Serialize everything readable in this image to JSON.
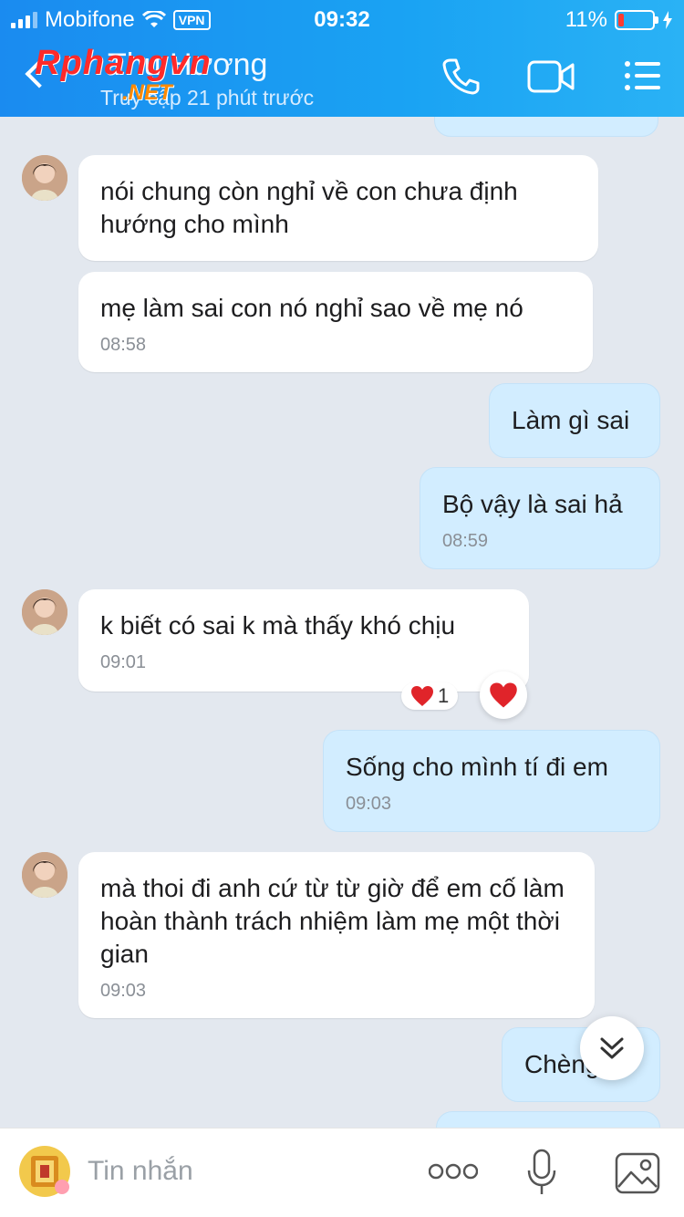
{
  "status_bar": {
    "carrier": "Mobifone",
    "vpn": "VPN",
    "time": "09:32",
    "battery": "11%",
    "battery_level": 0.11
  },
  "header": {
    "contact_name": "Thu Hương",
    "last_seen": "Truy cập 21 phút trước",
    "watermark_main": "Rphangvn",
    "watermark_sub": ".NET",
    "icons": [
      "back-icon",
      "phone-icon",
      "video-call-icon",
      "menu-icon"
    ]
  },
  "messages": [
    {
      "dir": "in",
      "text": "nói chung còn nghỉ về con chưa định hướng cho mình",
      "time": ""
    },
    {
      "dir": "in",
      "text": "mẹ làm sai con nó nghỉ sao về mẹ nó",
      "time": "08:58"
    },
    {
      "dir": "out",
      "text": "Làm gì sai",
      "time": ""
    },
    {
      "dir": "out",
      "text": "Bộ vậy là sai hả",
      "time": "08:59"
    },
    {
      "dir": "in",
      "text": "k biết có sai k mà thấy khó chịu",
      "time": "09:01"
    },
    {
      "dir": "out",
      "text": "Sống cho mình tí đi em",
      "time": "09:03"
    },
    {
      "dir": "in",
      "text": "mà thoi đi anh cứ từ từ giờ để em cố làm hoàn thành trách nhiệm làm mẹ một thời gian",
      "time": "09:03"
    },
    {
      "dir": "out",
      "text": "Chèng ơi",
      "time": ""
    }
  ],
  "reaction": {
    "emoji": "heart",
    "count": "1"
  },
  "input_bar": {
    "placeholder": "Tin nhắn",
    "icons": [
      "sticker-icon",
      "more-icon",
      "microphone-icon",
      "image-icon"
    ]
  }
}
